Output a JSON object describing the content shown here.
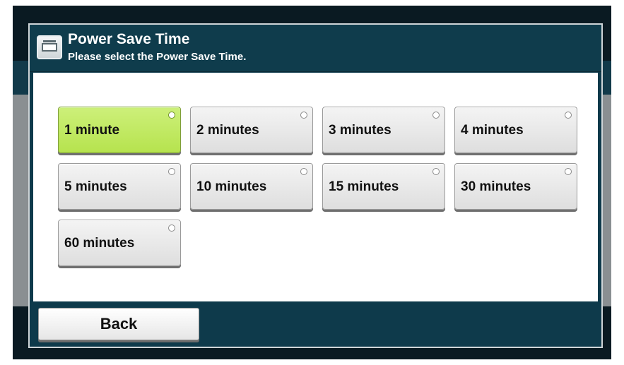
{
  "dialog": {
    "title": "Power Save Time",
    "subtitle": "Please select the Power Save Time.",
    "icon": "device-panel-icon"
  },
  "options": [
    {
      "label": "1 minute",
      "selected": true
    },
    {
      "label": "2 minutes",
      "selected": false
    },
    {
      "label": "3 minutes",
      "selected": false
    },
    {
      "label": "4 minutes",
      "selected": false
    },
    {
      "label": "5 minutes",
      "selected": false
    },
    {
      "label": "10 minutes",
      "selected": false
    },
    {
      "label": "15 minutes",
      "selected": false
    },
    {
      "label": "30 minutes",
      "selected": false
    },
    {
      "label": "60 minutes",
      "selected": false
    }
  ],
  "footer": {
    "back_label": "Back"
  },
  "colors": {
    "selected_fill": "#b6e34e",
    "header_bg": "#0f3c4c",
    "content_bg": "#ffffff"
  }
}
